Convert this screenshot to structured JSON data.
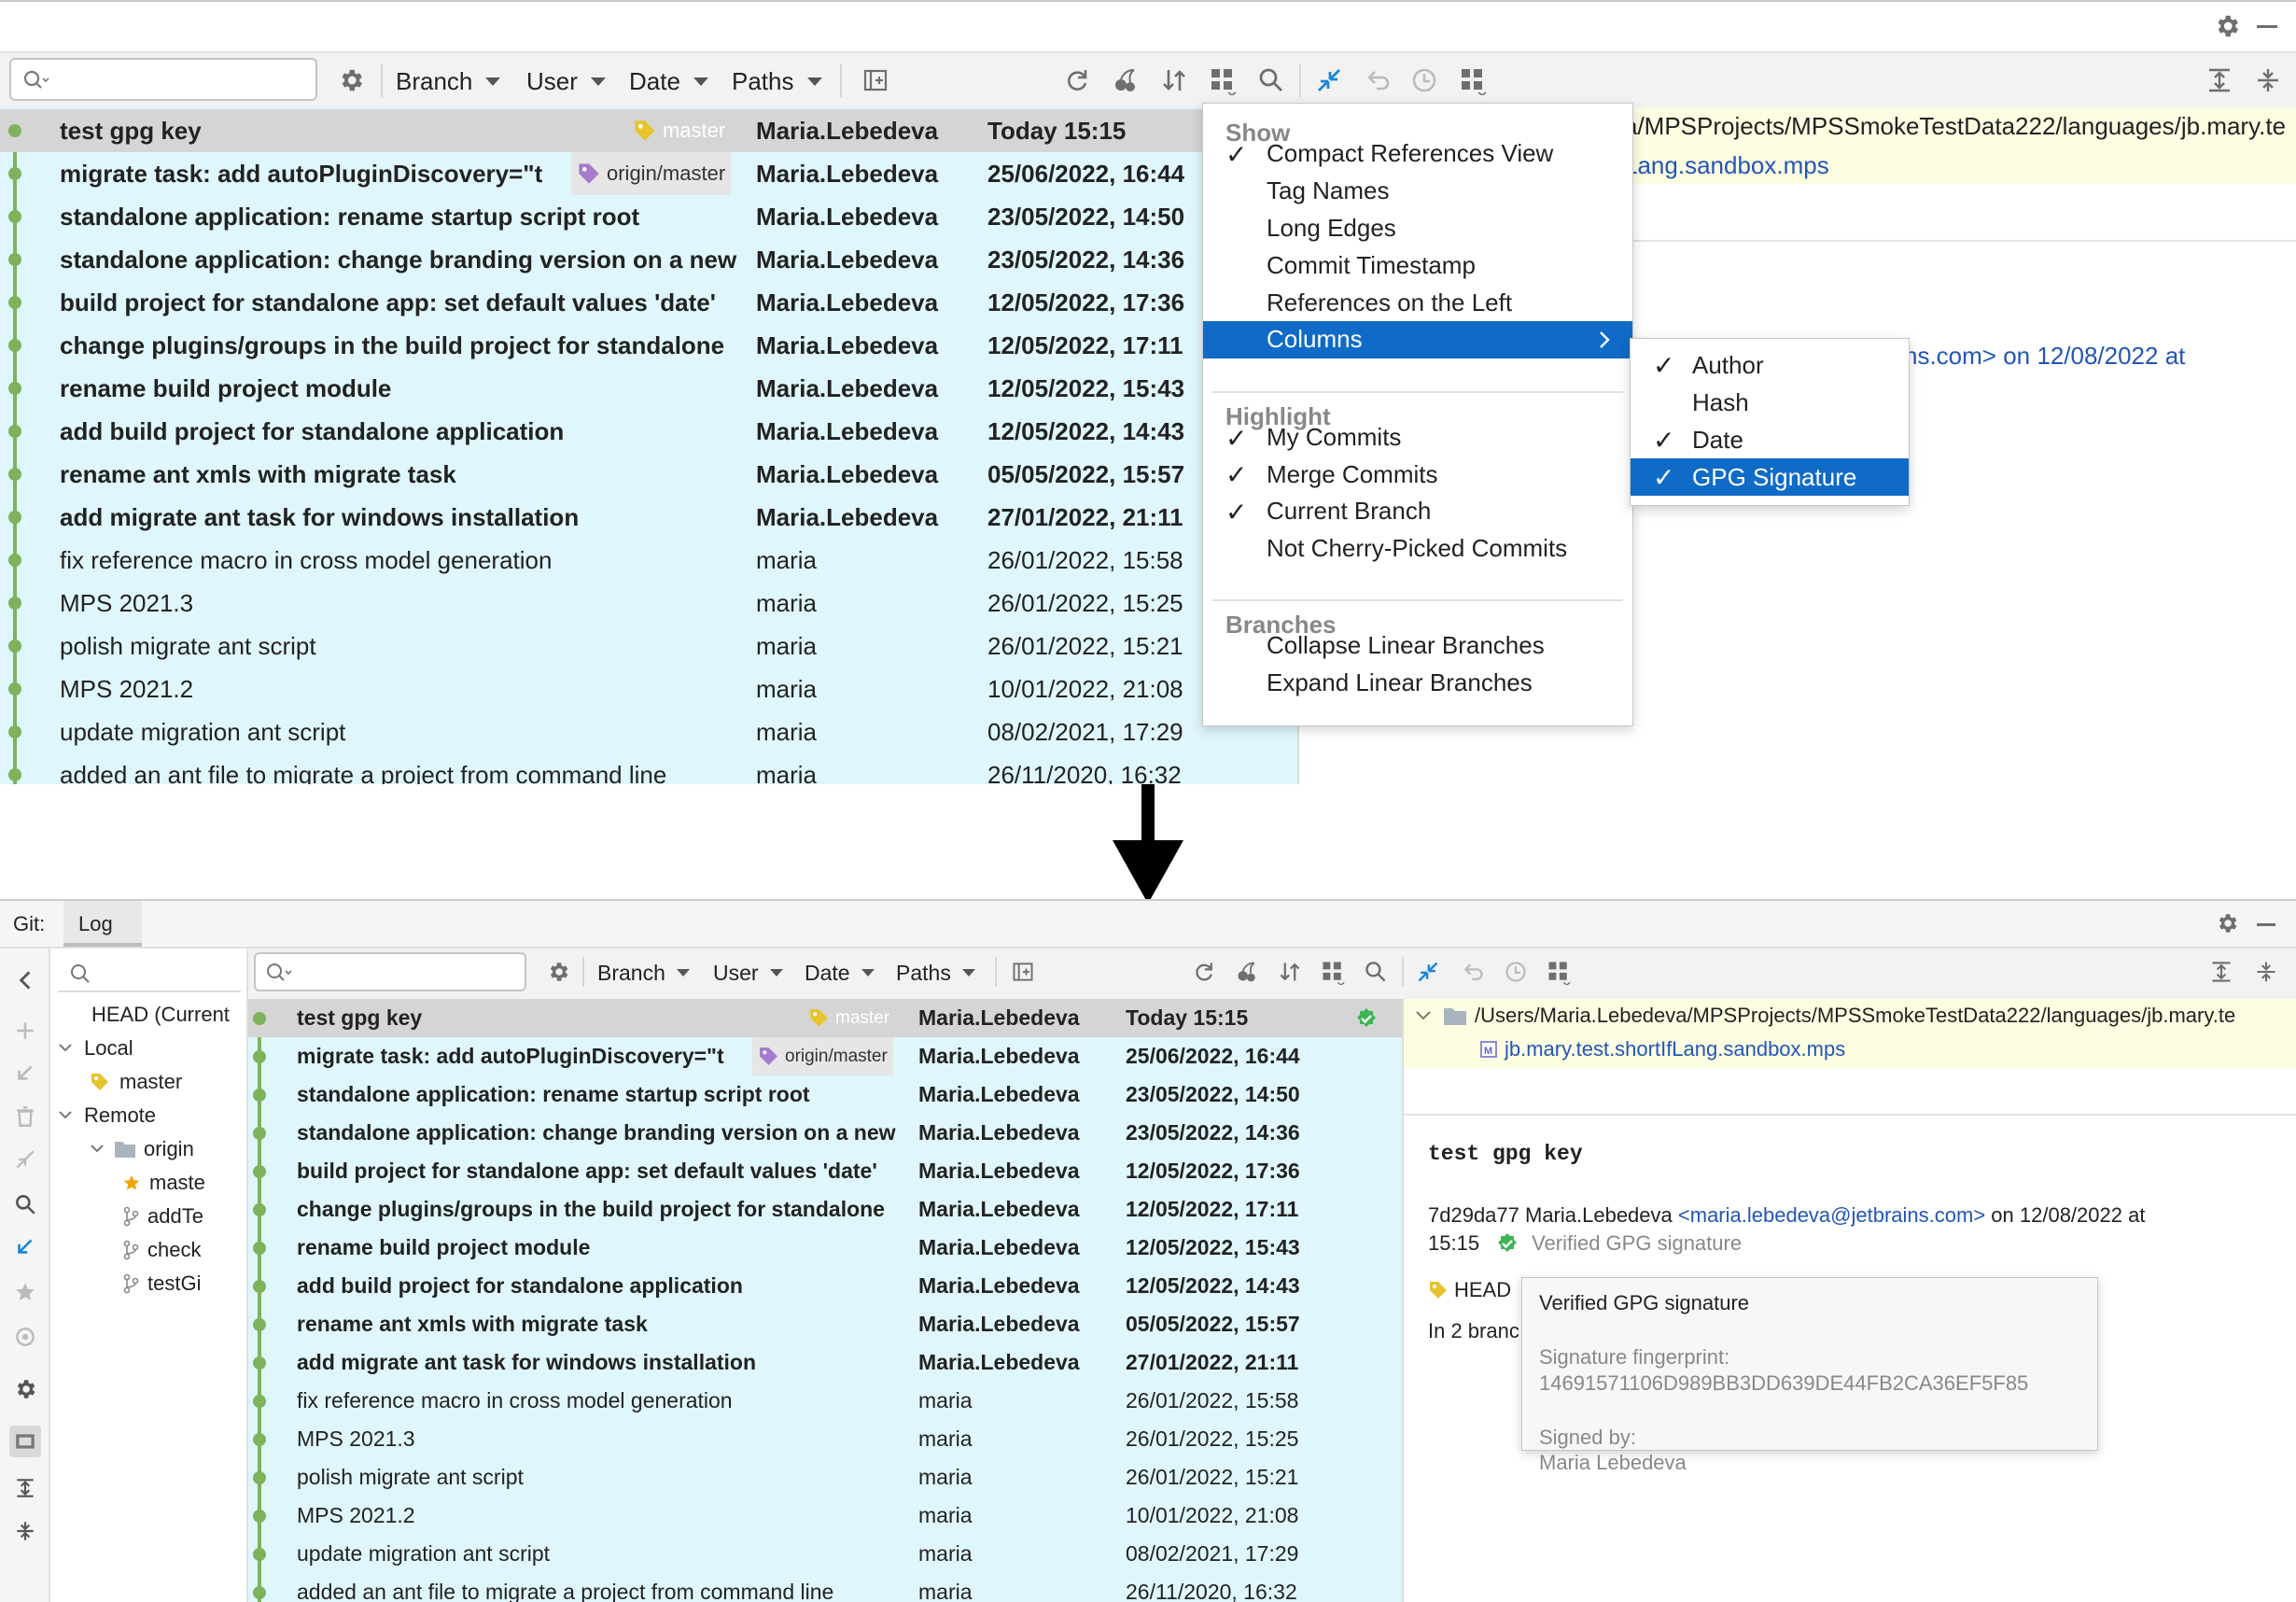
{
  "toolbar": {
    "filters": [
      "Branch",
      "User",
      "Date",
      "Paths"
    ]
  },
  "commits": [
    {
      "message": "test gpg key",
      "author": "Maria.Lebedeva",
      "date": "Today 15:15",
      "bold": true,
      "ref": "master"
    },
    {
      "message": "migrate task: add autoPluginDiscovery=\"t",
      "author": "Maria.Lebedeva",
      "date": "25/06/2022, 16:44",
      "bold": true,
      "ref": "origin/master"
    },
    {
      "message": "standalone application: rename startup script root",
      "author": "Maria.Lebedeva",
      "date": "23/05/2022, 14:50",
      "bold": true
    },
    {
      "message": "standalone application: change branding version on a new",
      "author": "Maria.Lebedeva",
      "date": "23/05/2022, 14:36",
      "bold": true
    },
    {
      "message": "build project for standalone app: set default values 'date'",
      "author": "Maria.Lebedeva",
      "date": "12/05/2022, 17:36",
      "bold": true
    },
    {
      "message": "change plugins/groups in the build project for standalone",
      "author": "Maria.Lebedeva",
      "date": "12/05/2022, 17:11",
      "bold": true
    },
    {
      "message": "rename build project module",
      "author": "Maria.Lebedeva",
      "date": "12/05/2022, 15:43",
      "bold": true
    },
    {
      "message": "add build project for standalone application",
      "author": "Maria.Lebedeva",
      "date": "12/05/2022, 14:43",
      "bold": true
    },
    {
      "message": "rename ant xmls with migrate task",
      "author": "Maria.Lebedeva",
      "date": "05/05/2022, 15:57",
      "bold": true
    },
    {
      "message": "add migrate ant task for windows installation",
      "author": "Maria.Lebedeva",
      "date": "27/01/2022, 21:11",
      "bold": true
    },
    {
      "message": "fix reference macro in cross model generation",
      "author": "maria",
      "date": "26/01/2022, 15:58",
      "bold": false
    },
    {
      "message": "MPS 2021.3",
      "author": "maria",
      "date": "26/01/2022, 15:25",
      "bold": false
    },
    {
      "message": "polish migrate ant script",
      "author": "maria",
      "date": "26/01/2022, 15:21",
      "bold": false
    },
    {
      "message": "MPS 2021.2",
      "author": "maria",
      "date": "10/01/2022, 21:08",
      "bold": false
    },
    {
      "message": "update migration ant script",
      "author": "maria",
      "date": "08/02/2021, 17:29",
      "bold": false
    },
    {
      "message": "added an ant file to migrate a project from command line",
      "author": "maria",
      "date": "26/11/2020, 16:32",
      "bold": false
    }
  ],
  "details_top": {
    "path": "a/MPSProjects/MPSSmokeTestData222/languages/jb.mary.te",
    "file": "Lang.sandbox.mps",
    "author_line": "ns.com> on 12/08/2022 at"
  },
  "menu": {
    "show_header": "Show",
    "show_items": [
      {
        "label": "Compact References View",
        "checked": true
      },
      {
        "label": "Tag Names",
        "checked": false
      },
      {
        "label": "Long Edges",
        "checked": false
      },
      {
        "label": "Commit Timestamp",
        "checked": false
      },
      {
        "label": "References on the Left",
        "checked": false
      },
      {
        "label": "Columns",
        "checked": false
      }
    ],
    "highlight_header": "Highlight",
    "highlight_items": [
      {
        "label": "My Commits",
        "checked": true
      },
      {
        "label": "Merge Commits",
        "checked": true
      },
      {
        "label": "Current Branch",
        "checked": true
      },
      {
        "label": "Not Cherry-Picked Commits",
        "checked": false
      }
    ],
    "branches_header": "Branches",
    "branches_items": [
      {
        "label": "Collapse Linear Branches"
      },
      {
        "label": "Expand Linear Branches"
      }
    ]
  },
  "submenu": [
    {
      "label": "Author",
      "checked": true
    },
    {
      "label": "Hash",
      "checked": false
    },
    {
      "label": "Date",
      "checked": true
    },
    {
      "label": "GPG Signature",
      "checked": true
    }
  ],
  "bottom": {
    "git_label": "Git:",
    "tab": "Log",
    "tree": [
      {
        "label": "HEAD (Current",
        "level": 0,
        "icon": "none"
      },
      {
        "label": "Local",
        "level": 0,
        "icon": "chevron"
      },
      {
        "label": "master",
        "level": 1,
        "icon": "tag"
      },
      {
        "label": "Remote",
        "level": 0,
        "icon": "chevron"
      },
      {
        "label": "origin",
        "level": 1,
        "icon": "folder"
      },
      {
        "label": "maste",
        "level": 2,
        "icon": "star"
      },
      {
        "label": "addTe",
        "level": 2,
        "icon": "branch"
      },
      {
        "label": "check",
        "level": 2,
        "icon": "branch"
      },
      {
        "label": "testGi",
        "level": 2,
        "icon": "branch"
      }
    ],
    "details": {
      "path": "/Users/Maria.Lebedeva/MPSProjects/MPSSmokeTestData222/languages/jb.mary.te",
      "file": "jb.mary.test.shortIfLang.sandbox.mps",
      "commit_title": "test gpg key",
      "hash_author": "7d29da77 Maria.Lebedeva",
      "email": "<maria.lebedeva@jetbrains.com>",
      "date_suffix": "on 12/08/2022 at",
      "time": "15:15",
      "verified": "Verified GPG signature",
      "head_label": "HEAD",
      "in_branches": "In 2 branc"
    },
    "tooltip": {
      "title": "Verified GPG signature",
      "fp_label": "Signature fingerprint:",
      "fp_value": "14691571106D989BB3DD639DE44FB2CA36EF5F85",
      "signed_label": "Signed by:",
      "signed_value": "Maria Lebedeva"
    }
  },
  "colors": {
    "highlight": "#dff6fc",
    "selected_row": "#d5d5d5",
    "graph": "#7db35b",
    "accent": "#0f6bc7",
    "verified": "#3fb458",
    "tag_yellow": "#e7c32e",
    "tag_purple": "#a67bcd"
  }
}
